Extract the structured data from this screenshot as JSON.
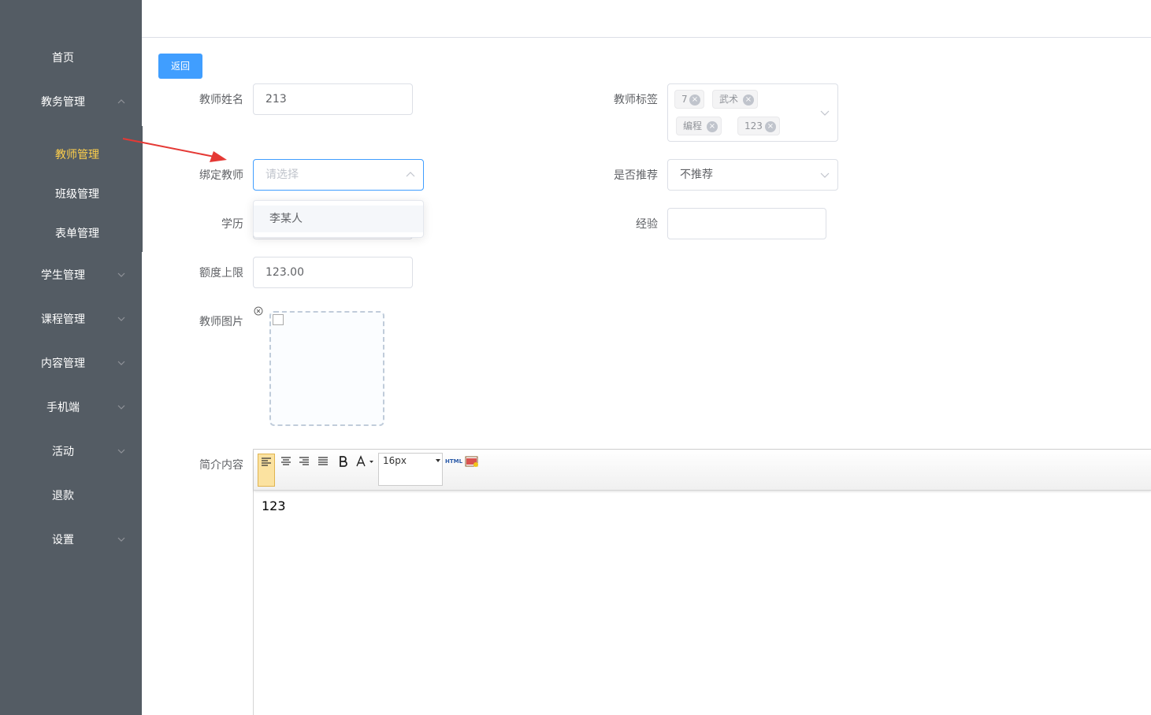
{
  "sidebar": {
    "home": "首页",
    "academic": "教务管理",
    "sub": [
      "教师管理",
      "班级管理",
      "表单管理"
    ],
    "items": [
      "学生管理",
      "课程管理",
      "内容管理",
      "手机端",
      "活动",
      "退款",
      "设置"
    ]
  },
  "back_label": "返回",
  "form": {
    "name_label": "教师姓名",
    "name_value": "213",
    "tags_label": "教师标签",
    "tags": [
      "7",
      "武术",
      "编程",
      "123"
    ],
    "bind_label": "绑定教师",
    "bind_placeholder": "请选择",
    "bind_option": "李某人",
    "recommend_label": "是否推荐",
    "recommend_value": "不推荐",
    "education_label": "学历",
    "experience_label": "经验",
    "quota_label": "额度上限",
    "quota_value": "123.00",
    "photo_label": "教师图片",
    "intro_label": "简介内容"
  },
  "editor": {
    "font_size": "16px",
    "html_label": "HTML",
    "content": "123"
  },
  "colors": {
    "sidebar": "#545c64",
    "active": "#ffd04b",
    "primary": "#409eff"
  }
}
